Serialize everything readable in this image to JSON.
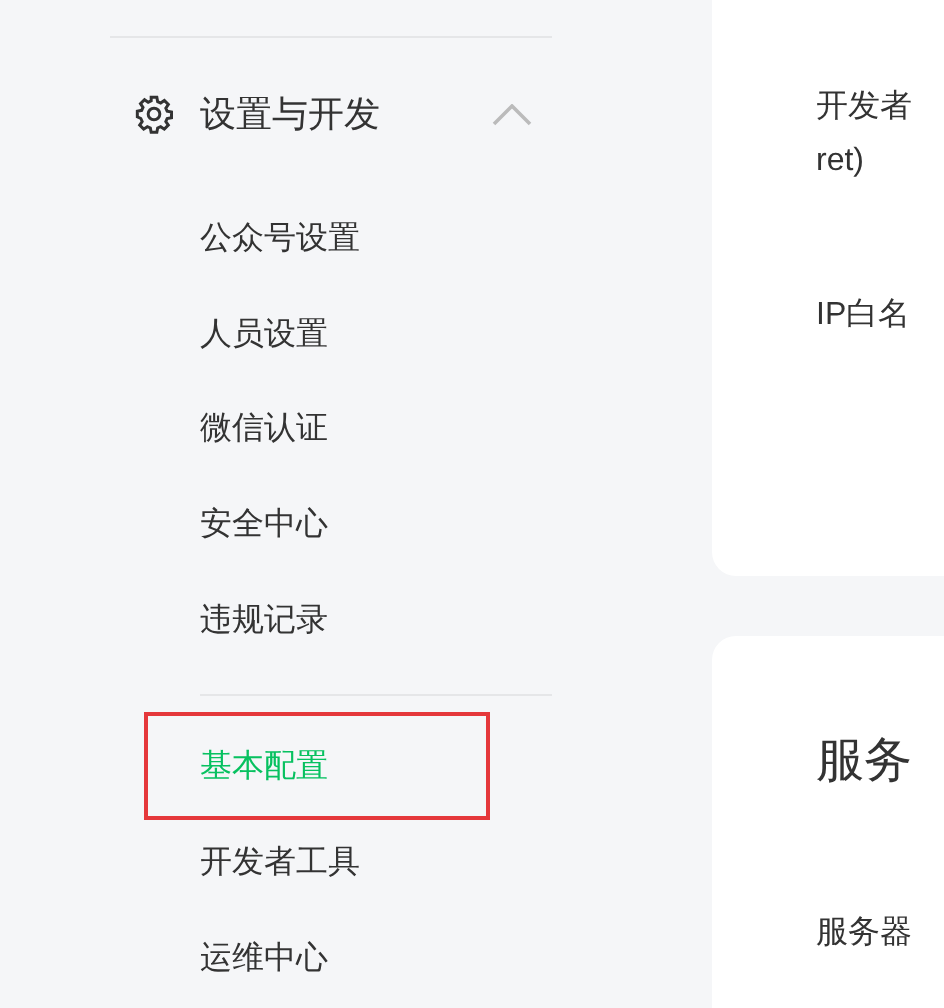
{
  "sidebar": {
    "group": {
      "label": "设置与开发",
      "expanded": true,
      "items": [
        {
          "label": "公众号设置",
          "selected": false
        },
        {
          "label": "人员设置",
          "selected": false
        },
        {
          "label": "微信认证",
          "selected": false
        },
        {
          "label": "安全中心",
          "selected": false
        },
        {
          "label": "违规记录",
          "selected": false
        }
      ],
      "items_2": [
        {
          "label": "基本配置",
          "selected": true,
          "highlighted": true
        },
        {
          "label": "开发者工具",
          "selected": false,
          "highlighted": false
        },
        {
          "label": "运维中心",
          "selected": false,
          "highlighted": false
        }
      ]
    }
  },
  "cards": [
    {
      "rows": [
        {
          "lines": [
            "开发者",
            "ret)"
          ]
        },
        {
          "lines": [
            "IP白名"
          ]
        }
      ]
    },
    {
      "title": "服务",
      "rows": [
        {
          "lines": [
            "服务器"
          ]
        }
      ]
    }
  ]
}
